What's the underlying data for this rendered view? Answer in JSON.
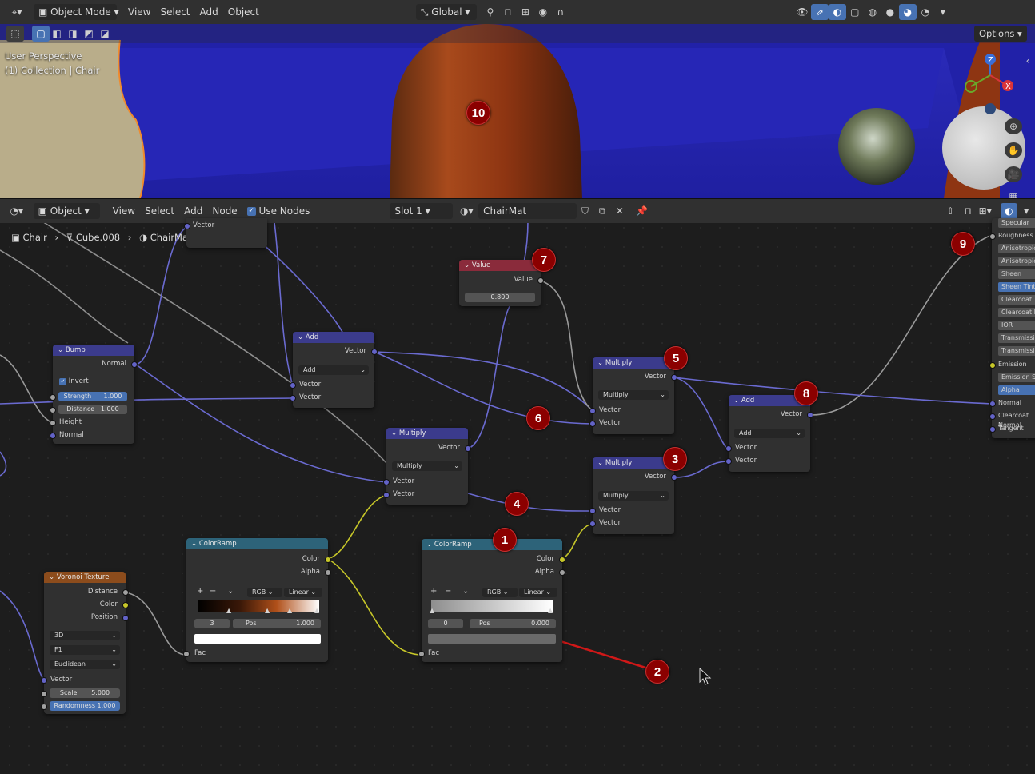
{
  "viewport": {
    "header": {
      "mode": "Object Mode",
      "menus": [
        "View",
        "Select",
        "Add",
        "Object"
      ],
      "transform_orientation": "Global",
      "options_label": "Options"
    },
    "overlay_line1": "User Perspective",
    "overlay_line2": "(1) Collection | Chair",
    "gizmo_axes": [
      "Z",
      "X"
    ]
  },
  "node_editor": {
    "header": {
      "editor_mode": "Object",
      "menus": [
        "View",
        "Select",
        "Add",
        "Node"
      ],
      "use_nodes_label": "Use Nodes",
      "use_nodes_checked": true,
      "slot": "Slot 1",
      "material": "ChairMat"
    },
    "breadcrumb": [
      "Chair",
      "Cube.008",
      "ChairMat"
    ],
    "nodes": {
      "top_fragment": {
        "socket": "Vector"
      },
      "bump": {
        "title": "Bump",
        "out_normal": "Normal",
        "invert": "Invert",
        "strength_label": "Strength",
        "strength": "1.000",
        "distance_label": "Distance",
        "distance": "1.000",
        "in_height": "Height",
        "in_normal": "Normal"
      },
      "add_top": {
        "title": "Add",
        "out": "Vector",
        "op": "Add",
        "in1": "Vector",
        "in2": "Vector"
      },
      "value": {
        "title": "Value",
        "out": "Value",
        "value": "0.800"
      },
      "multiply_mid": {
        "title": "Multiply",
        "out": "Vector",
        "op": "Multiply",
        "in1": "Vector",
        "in2": "Vector"
      },
      "multiply_5": {
        "title": "Multiply",
        "out": "Vector",
        "op": "Multiply",
        "in1": "Vector",
        "in2": "Vector"
      },
      "multiply_3": {
        "title": "Multiply",
        "out": "Vector",
        "op": "Multiply",
        "in1": "Vector",
        "in2": "Vector"
      },
      "add_8": {
        "title": "Add",
        "out": "Vector",
        "op": "Add",
        "in1": "Vector",
        "in2": "Vector"
      },
      "colorramp_left": {
        "title": "ColorRamp",
        "out_color": "Color",
        "out_alpha": "Alpha",
        "color_mode": "RGB",
        "interpolation": "Linear",
        "index": "3",
        "pos_label": "Pos",
        "pos": "1.000",
        "in_fac": "Fac",
        "stops_color": "#ffffff"
      },
      "colorramp_right": {
        "title": "ColorRamp",
        "out_color": "Color",
        "out_alpha": "Alpha",
        "color_mode": "RGB",
        "interpolation": "Linear",
        "index": "0",
        "pos_label": "Pos",
        "pos": "0.000",
        "in_fac": "Fac",
        "stops_color": "#6a6a6a"
      },
      "voronoi": {
        "title": "Voronoi Texture",
        "out_distance": "Distance",
        "out_color": "Color",
        "out_position": "Position",
        "dimensions": "3D",
        "feature": "F1",
        "metric": "Euclidean",
        "in_vector": "Vector",
        "scale_label": "Scale",
        "scale": "5.000",
        "randomness_label": "Randomness",
        "randomness": "1.000"
      }
    },
    "bsdf_inputs": [
      "Specular",
      "Roughness",
      "Anisotropic",
      "Anisotropic Rotation",
      "Sheen",
      "Sheen Tint",
      "Clearcoat",
      "Clearcoat Roughness",
      "IOR",
      "Transmission",
      "Transmission Roughness",
      "Emission",
      "Emission Strength",
      "Alpha",
      "Normal",
      "Clearcoat Normal",
      "Tangent"
    ]
  },
  "markers": [
    "1",
    "2",
    "3",
    "4",
    "5",
    "6",
    "7",
    "8",
    "9",
    "10"
  ],
  "colors": {
    "accent": "#4772b3",
    "vector_header": "#3b3b8c",
    "converter_header": "#2d6379",
    "input_header": "#8a2b3b",
    "texture_header": "#8c4c1c",
    "marker": "#8b0000"
  }
}
